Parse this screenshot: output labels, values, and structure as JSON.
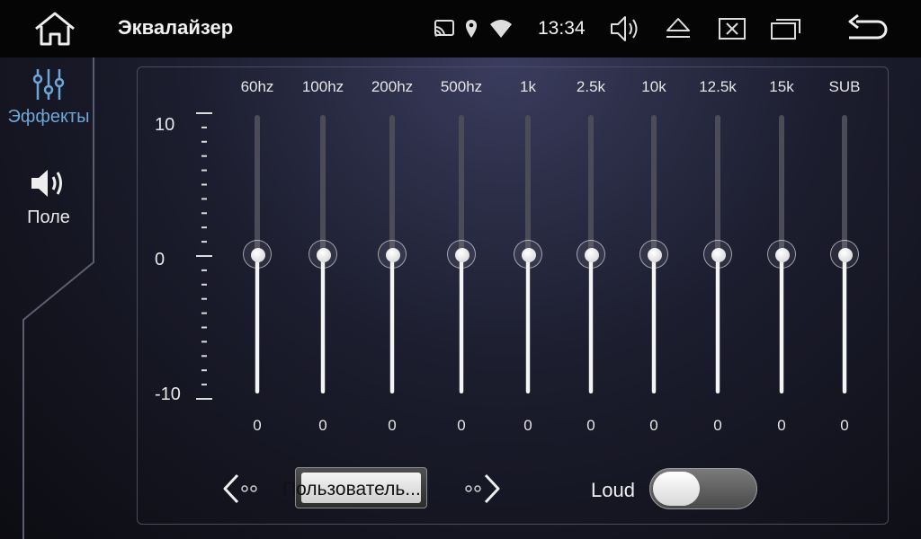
{
  "header": {
    "title": "Эквалайзер",
    "time": "13:34"
  },
  "sidebar": {
    "items": [
      {
        "label": "Эффекты",
        "icon": "sliders-icon",
        "active": true
      },
      {
        "label": "Поле",
        "icon": "speaker-icon",
        "active": false
      }
    ]
  },
  "equalizer": {
    "scale": {
      "max": "10",
      "mid": "0",
      "min": "-10"
    },
    "bands": [
      {
        "label": "60hz",
        "value": "0"
      },
      {
        "label": "100hz",
        "value": "0"
      },
      {
        "label": "200hz",
        "value": "0"
      },
      {
        "label": "500hz",
        "value": "0"
      },
      {
        "label": "1k",
        "value": "0"
      },
      {
        "label": "2.5k",
        "value": "0"
      },
      {
        "label": "10k",
        "value": "0"
      },
      {
        "label": "12.5k",
        "value": "0"
      },
      {
        "label": "15k",
        "value": "0"
      },
      {
        "label": "SUB",
        "value": "0"
      }
    ]
  },
  "controls": {
    "preset_label": "Пользователь...",
    "loud_label": "Loud",
    "loud_on": false
  },
  "colors": {
    "accent": "#6fa6d8",
    "topbar": "#050506"
  }
}
